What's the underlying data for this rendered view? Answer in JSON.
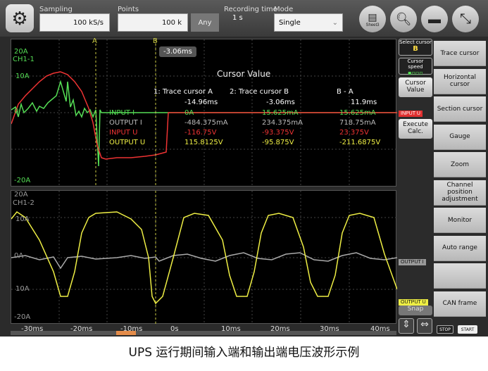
{
  "toolbar": {
    "sampling_label": "Sampling",
    "sampling_value": "100 kS/s",
    "points_label": "Points",
    "points_value": "100 k",
    "any_button": "Any",
    "recording_label": "Recording time",
    "recording_value": "1 s",
    "mode_label": "Mode",
    "mode_value": "Single",
    "sheet_label": "Sheet3"
  },
  "cursor_marker": {
    "a_label": "A",
    "b_label": "B",
    "readout": "-3.06ms"
  },
  "plot1": {
    "ch_label": "CH1-1",
    "y_top": "20A",
    "y_mid": "10A",
    "y_zero": "0",
    "y_bottom": "-20A"
  },
  "plot2": {
    "ch_label": "CH1-2",
    "y_top": "20A",
    "y_upper": "10A",
    "y_zero": "0A",
    "y_lower": "10A",
    "y_bottom": "-20A"
  },
  "cursor_value": {
    "title": "Cursor Value",
    "headers": [
      "1: Trace cursor A",
      "2: Trace cursor B",
      "B - A"
    ],
    "time_row": [
      "-14.96ms",
      "-3.06ms",
      "11.9ms"
    ],
    "rows": [
      {
        "name": "INPUT I",
        "a": "0A",
        "b": "15.625mA",
        "ba": "15.625mA",
        "color": "#55dd55"
      },
      {
        "name": "OUTPUT I",
        "a": "-484.375mA",
        "b": "234.375mA",
        "ba": "718.75mA",
        "color": "#bbbbbb"
      },
      {
        "name": "INPUT U",
        "a": "-116.75V",
        "b": "-93.375V",
        "ba": "23.375V",
        "color": "#ee3333"
      },
      {
        "name": "OUTPUT U",
        "a": "115.8125V",
        "b": "-95.875V",
        "ba": "-211.6875V",
        "color": "#eeee44"
      }
    ]
  },
  "timeline": {
    "ticks": [
      "-30ms",
      "-20ms",
      "-10ms",
      "0s",
      "10ms",
      "20ms",
      "30ms",
      "40ms"
    ]
  },
  "side_panel": {
    "select_cursor": "Select cursor",
    "select_cursor_value": "B",
    "cursor_speed": "Cursor speed",
    "cursor_value_btn": "Cursor Value",
    "execute_calc": "Execute Calc.",
    "snap": "Snap"
  },
  "trace_tags": {
    "input_u": "INPUT U",
    "output_i": "OUTPUT I",
    "output_u": "OUTPUT U"
  },
  "menu": {
    "items": [
      "Trace cursor",
      "Horizontal cursor",
      "Section cursor",
      "Gauge",
      "Zoom",
      "Channel position adjustment",
      "Monitor",
      "Auto range",
      "",
      "CAN frame"
    ],
    "stop": "STOP",
    "start": "START"
  },
  "caption": "UPS 运行期间输入端和输出端电压波形示例",
  "colors": {
    "input_i": "#55dd55",
    "output_i": "#aaaaaa",
    "input_u": "#ee3333",
    "output_u": "#eeee44"
  }
}
